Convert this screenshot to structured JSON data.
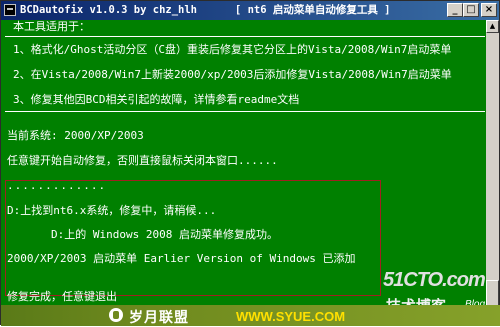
{
  "window": {
    "title": "BCDautofix v1.0.3 by chz_hlh      [ nt6 启动菜单自动修复工具 ]",
    "buttons": {
      "minimize": "_",
      "maximize": "□",
      "close": "×"
    }
  },
  "console": {
    "header": "本工具适用于：",
    "items": [
      "1、格式化/Ghost活动分区（C盘）重装后修复其它分区上的Vista/2008/Win7启动菜单",
      "2、在Vista/2008/Win7上新装2000/xp/2003后添加修复Vista/2008/Win7启动菜单",
      "3、修复其他因BCD相关引起的故障，详情参看readme文档"
    ],
    "current_system": "当前系统: 2000/XP/2003",
    "prompt": "任意键开始自动修复，否则直接鼠标关闭本窗口......",
    "dots": ".............",
    "found": "D:上找到nt6.x系统，修复中，请稍候...",
    "repaired": "D:上的 Windows 2008 启动菜单修复成功。",
    "added": "2000/XP/2003 启动菜单 Earlier Version of Windows 已添加",
    "done": "修复完成，任意键退出"
  },
  "watermark": {
    "site": "51CTO.com",
    "blog_cn": "技术博客",
    "blog_en": "Blog"
  },
  "footer": {
    "brand": "岁月联盟",
    "url": "WWW.SYUE.COM"
  }
}
